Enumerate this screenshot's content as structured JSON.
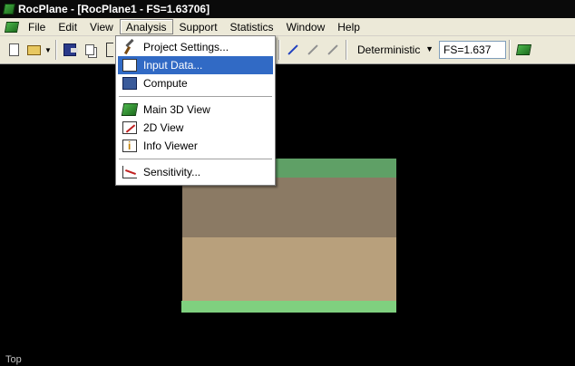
{
  "window": {
    "title": "RocPlane - [RocPlane1 - FS=1.63706]"
  },
  "menubar": {
    "items": [
      {
        "label": "File"
      },
      {
        "label": "Edit"
      },
      {
        "label": "View"
      },
      {
        "label": "Analysis"
      },
      {
        "label": "Support"
      },
      {
        "label": "Statistics"
      },
      {
        "label": "Window"
      },
      {
        "label": "Help"
      }
    ]
  },
  "toolbar": {
    "mode_select": "Deterministic",
    "fs_value": "FS=1.637"
  },
  "analysis_menu": {
    "items": [
      {
        "label": "Project Settings...",
        "icon": "settings-icon"
      },
      {
        "label": "Input Data...",
        "icon": "input-data-icon",
        "highlighted": true
      },
      {
        "label": "Compute",
        "icon": "compute-icon"
      },
      {
        "label": "Main 3D View",
        "icon": "3d-view-icon"
      },
      {
        "label": "2D View",
        "icon": "2d-view-icon"
      },
      {
        "label": "Info Viewer",
        "icon": "info-viewer-icon"
      },
      {
        "label": "Sensitivity...",
        "icon": "sensitivity-icon"
      }
    ]
  },
  "viewport": {
    "view_label": "Top"
  },
  "colors": {
    "top_green": "#5fa066",
    "dark_band": "#8b7a64",
    "light_band": "#b8a07c",
    "bottom_green": "#7fd07f",
    "highlight": "#316ac5"
  }
}
